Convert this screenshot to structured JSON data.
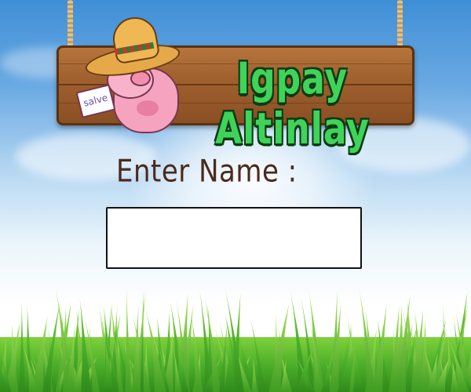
{
  "sign": {
    "title": "Igpay Altinlay",
    "card_text": "salve"
  },
  "form": {
    "name_label": "Enter Name :",
    "name_value": "",
    "name_placeholder": ""
  },
  "icons": {
    "mascot": "pig-with-sombrero-icon"
  },
  "colors": {
    "sky_top": "#3f8fd6",
    "title_green": "#3fd35a",
    "wood": "#a0612f",
    "label_brown": "#4a2a1c",
    "grass_green": "#4caf2a"
  }
}
